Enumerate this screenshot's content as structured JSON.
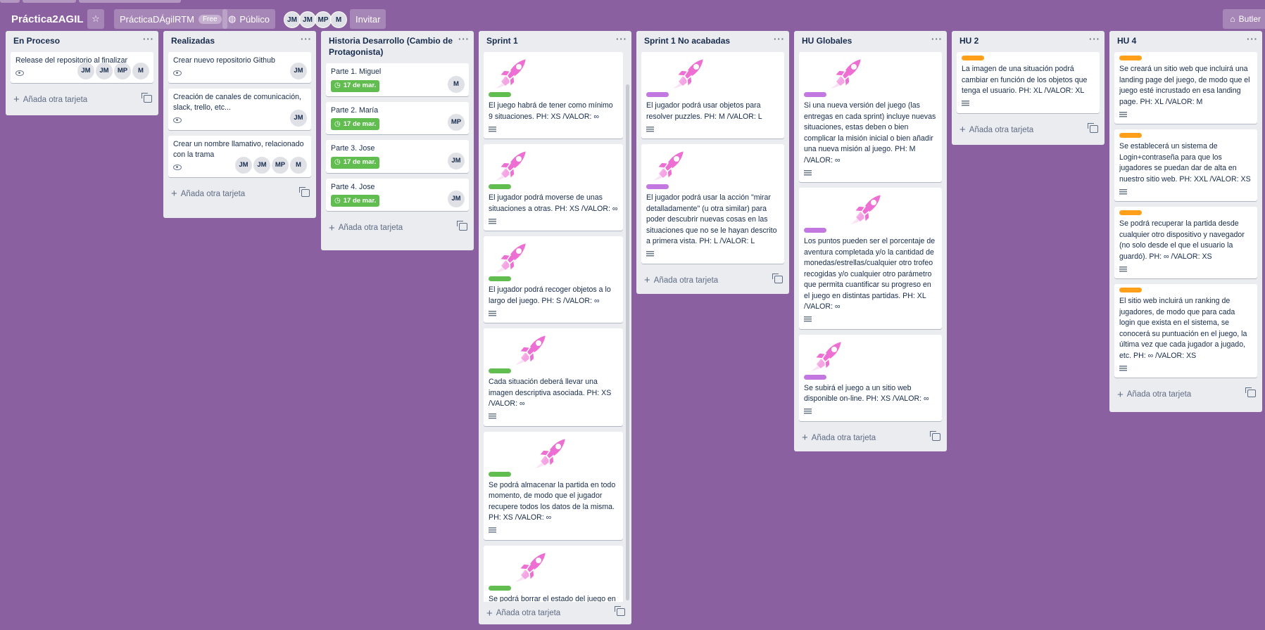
{
  "header": {
    "board_title": "Práctica2AGIL",
    "workspace": "PrácticaDÁgilRTM",
    "plan_badge": "Free",
    "visibility": "Público",
    "members": [
      "JM",
      "JM",
      "MP",
      "M"
    ],
    "invite": "Invitar",
    "butler": "Butler"
  },
  "add_card_label": "Añada otra tarjeta",
  "colors": {
    "background": "#8a60a0",
    "green": "#61bd4f",
    "purple": "#c377e0",
    "orange": "#ff9f1a",
    "rocket": "#ee6fd3"
  },
  "lists": [
    {
      "title": "En Proceso",
      "cards": [
        {
          "title": "Release del repositorio al finalizar",
          "watch": true,
          "members": [
            "JM",
            "JM",
            "MP",
            "M"
          ]
        }
      ]
    },
    {
      "title": "Realizadas",
      "cards": [
        {
          "title": "Crear nuevo repositorio Github",
          "watch": true,
          "members": [
            "JM"
          ]
        },
        {
          "title": "Creación de canales de comunicación, slack, trello, etc...",
          "watch": true,
          "members": [
            "JM"
          ]
        },
        {
          "title": "Crear un nombre llamativo, relacionado con la trama",
          "watch": true,
          "members": [
            "JM",
            "JM",
            "MP",
            "M"
          ]
        }
      ]
    },
    {
      "title": "Historia Desarrollo (Cambio de Protagonista)",
      "cards": [
        {
          "title": "Parte 1. Miguel",
          "due": "17 de mar.",
          "members": [
            "M"
          ]
        },
        {
          "title": "Parte 2. María",
          "due": "17 de mar.",
          "members": [
            "MP"
          ]
        },
        {
          "title": "Parte 3. Jose",
          "due": "17 de mar.",
          "members": [
            "JM"
          ]
        },
        {
          "title": "Parte 4. Jose",
          "due": "17 de mar.",
          "members": [
            "JM"
          ]
        }
      ]
    },
    {
      "title": "Sprint 1",
      "cards": [
        {
          "title": "El juego habrá de tener como mínimo 9 situaciones. PH: XS /VALOR: ∞",
          "label": "green",
          "cover": "left",
          "desc": true
        },
        {
          "title": "El jugador podrá moverse de unas situaciones a otras. PH: XS /VALOR: ∞",
          "label": "green",
          "cover": "left",
          "desc": true
        },
        {
          "title": "El jugador podrá recoger objetos a lo largo del juego. PH: S /VALOR: ∞",
          "label": "green",
          "cover": "left",
          "desc": true
        },
        {
          "title": "Cada situación deberá llevar una imagen descriptiva asociada. PH: XS /VALOR: ∞",
          "label": "green",
          "cover": "center",
          "desc": true
        },
        {
          "title": "Se podrá almacenar la partida en todo momento, de modo que el jugador recupere todos los datos de la misma. PH: XS /VALOR: ∞",
          "label": "green",
          "cover": "right",
          "desc": true
        },
        {
          "title": "Se podrá borrar el estado del juego en todo momento, para comenzar",
          "label": "green",
          "cover": "center",
          "desc": false
        }
      ]
    },
    {
      "title": "Sprint 1 No acabadas",
      "cards": [
        {
          "title": "El jugador podrá usar objetos para resolver puzzles. PH: M /VALOR: L",
          "label": "purple",
          "cover": "center",
          "desc": true
        },
        {
          "title": "El jugador podrá usar la acción \"mirar detalladamente\" (u otra similar) para poder descubrir nuevas cosas en las situaciones que no se le hayan descrito a primera vista. PH: L /VALOR: L",
          "label": "purple",
          "cover": "left",
          "desc": true
        }
      ]
    },
    {
      "title": "HU Globales",
      "cards": [
        {
          "title": "Si una nueva versión del juego (las entregas en cada sprint) incluye nuevas situaciones, estas deben o bien complicar la misión inicial o bien añadir una nueva misión al juego. PH: M /VALOR: ∞",
          "label": "purple",
          "cover": "center",
          "desc": true
        },
        {
          "title": "Los puntos pueden ser el porcentaje de aventura completada y/o la cantidad de monedas/estrellas/cualquier otro trofeo recogidas y/o cualquier otro parámetro que permita cuantificar su progreso en el juego en distintas partidas. PH: XL /VALOR: ∞",
          "label": "purple",
          "cover": "right",
          "desc": true
        },
        {
          "title": "Se subirá el juego a un sitio web disponible on-line. PH: XS /VALOR: ∞",
          "label": "purple",
          "cover": "left",
          "desc": true
        }
      ]
    },
    {
      "title": "HU 2",
      "cards": [
        {
          "title": "La imagen de una situación podrá cambiar en función de los objetos que tenga el usuario. PH: XL /VALOR: XL",
          "label": "orange",
          "desc": true
        }
      ]
    },
    {
      "title": "HU 4",
      "cards": [
        {
          "title": "Se creará un sitio web que incluirá una landing page del juego, de modo que el juego esté incrustado en esa landing page. PH: XL /VALOR: M",
          "label": "orange",
          "desc": true
        },
        {
          "title": "Se establecerá un sistema de Login+contraseña para que los jugadores se puedan dar de alta en nuestro sitio web. PH: XXL /VALOR: XS",
          "label": "orange",
          "desc": true
        },
        {
          "title": "Se podrá recuperar la partida desde cualquier otro dispositivo y navegador (no solo desde el que el usuario la guardó). PH: ∞ /VALOR: XS",
          "label": "orange",
          "desc": true
        },
        {
          "title": "El sitio web incluirá un ranking de jugadores, de modo que para cada login que exista en el sistema, se conocerá su puntuación en el juego, la última vez que cada jugador a jugado, etc. PH: ∞ /VALOR: XS",
          "label": "orange",
          "desc": true
        }
      ]
    }
  ]
}
